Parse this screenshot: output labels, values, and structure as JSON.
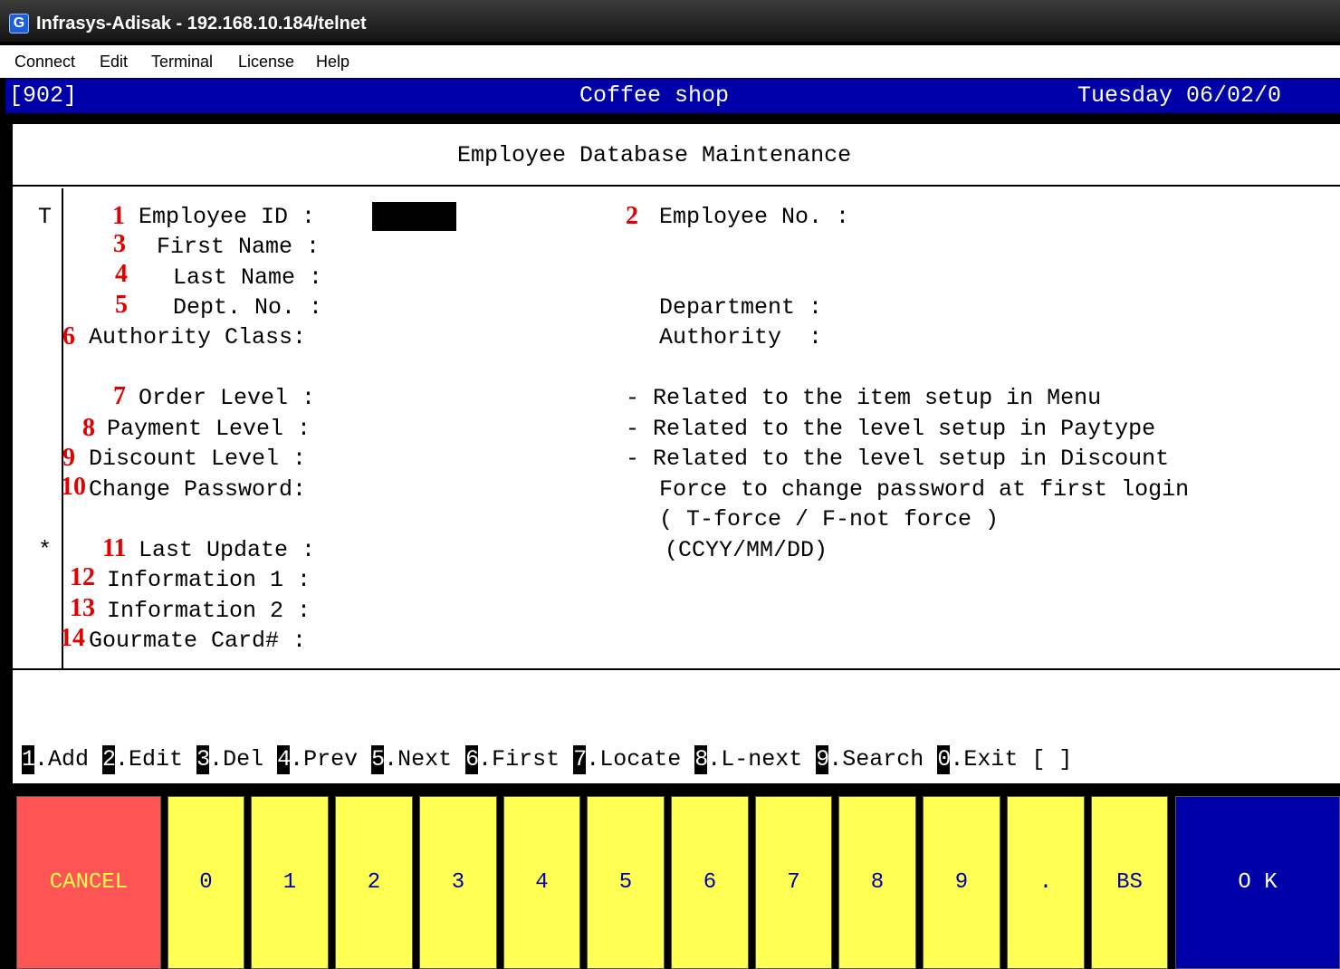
{
  "window": {
    "title": "Infrasys-Adisak - 192.168.10.184/telnet",
    "app_icon": "G"
  },
  "menu": [
    "Connect",
    "Edit",
    "Terminal",
    "License",
    "Help"
  ],
  "status": {
    "left": "[902]",
    "center": "Coffee shop",
    "right": "Tuesday 06/02/0"
  },
  "screen": {
    "title": "Employee Database Maintenance",
    "mode_flag": "T",
    "marker": "*",
    "fields": [
      {
        "num": "1",
        "label": "Employee ID :"
      },
      {
        "num": "3",
        "label": "First Name :"
      },
      {
        "num": "4",
        "label": "Last Name :"
      },
      {
        "num": "5",
        "label": "Dept. No. :"
      },
      {
        "num": "6",
        "label": "Authority Class:"
      },
      {
        "num": "7",
        "label": "Order Level :"
      },
      {
        "num": "8",
        "label": "Payment Level :"
      },
      {
        "num": "9",
        "label": "Discount Level :"
      },
      {
        "num": "10",
        "label": "Change Password:"
      },
      {
        "num": "11",
        "label": "Last Update :"
      },
      {
        "num": "12",
        "label": "Information 1 :"
      },
      {
        "num": "13",
        "label": "Information 2 :"
      },
      {
        "num": "14",
        "label": "Gourmate Card# :"
      }
    ],
    "right": {
      "emp_no_num": "2",
      "emp_no_label": "Employee No. :",
      "department": "Department :",
      "authority": "Authority  :",
      "order_note": "- Related to the item setup in Menu",
      "payment_note": "- Related to the level setup in Paytype",
      "discount_note": "- Related to the level setup in Discount",
      "password_note": "Force to change password at first login",
      "password_hint": "( T-force / F-not force )",
      "date_format": "(CCYY/MM/DD)"
    }
  },
  "function_keys": [
    {
      "key": "1",
      "label": ".Add"
    },
    {
      "key": "2",
      "label": ".Edit"
    },
    {
      "key": "3",
      "label": ".Del"
    },
    {
      "key": "4",
      "label": ".Prev"
    },
    {
      "key": "5",
      "label": ".Next"
    },
    {
      "key": "6",
      "label": ".First"
    },
    {
      "key": "7",
      "label": ".Locate"
    },
    {
      "key": "8",
      "label": ".L-next"
    },
    {
      "key": "9",
      "label": ".Search"
    },
    {
      "key": "0",
      "label": ".Exit"
    }
  ],
  "prompt": "[ ]",
  "keypad": [
    "CANCEL",
    "0",
    "1",
    "2",
    "3",
    "4",
    "5",
    "6",
    "7",
    "8",
    "9",
    ".",
    "BS",
    "O K"
  ],
  "colors": {
    "header_blue": "#0000a8",
    "key_yellow": "#ffff54",
    "cancel_red": "#ff5454",
    "annotation_red": "#e00000"
  }
}
